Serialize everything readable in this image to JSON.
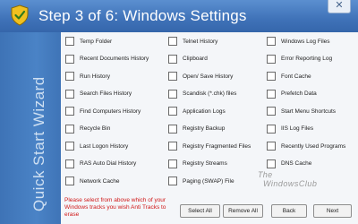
{
  "window": {
    "title": "Step 3 of 6: Windows Settings",
    "sidebar_label": "Quick Start Wizard",
    "close_glyph": "✕"
  },
  "options": [
    {
      "label": "Temp Folder",
      "checked": false
    },
    {
      "label": "Recent Documents History",
      "checked": false
    },
    {
      "label": "Run History",
      "checked": false
    },
    {
      "label": "Search Files History",
      "checked": false
    },
    {
      "label": "Find Computers History",
      "checked": false
    },
    {
      "label": "Recycle Bin",
      "checked": false
    },
    {
      "label": "Last Logon History",
      "checked": false
    },
    {
      "label": "RAS Auto Dial History",
      "checked": false
    },
    {
      "label": "Network Cache",
      "checked": false
    },
    {
      "label": "Telnet History",
      "checked": false
    },
    {
      "label": "Clipboard",
      "checked": false
    },
    {
      "label": "Open/ Save History",
      "checked": false
    },
    {
      "label": "Scandisk (*.chk) files",
      "checked": false
    },
    {
      "label": "Application Logs",
      "checked": false
    },
    {
      "label": "Registry Backup",
      "checked": false
    },
    {
      "label": "Registry Fragmented Files",
      "checked": false
    },
    {
      "label": "Registry Streams",
      "checked": false
    },
    {
      "label": "Paging (SWAP) File",
      "checked": false
    },
    {
      "label": "Windows Log Files",
      "checked": false
    },
    {
      "label": "Error Reporting Log",
      "checked": false
    },
    {
      "label": "Font Cache",
      "checked": false
    },
    {
      "label": "Prefetch Data",
      "checked": false
    },
    {
      "label": "Start Menu Shortcuts",
      "checked": false
    },
    {
      "label": "IIS Log Files",
      "checked": false
    },
    {
      "label": "Recently Used Programs",
      "checked": false
    },
    {
      "label": "DNS Cache",
      "checked": false
    }
  ],
  "footer": {
    "note": "Please select from above which of your Windows tracks you wish Anti Tracks to erase",
    "select_all": "Select All",
    "remove_all": "Remove All",
    "back": "Back",
    "next": "Next"
  },
  "watermark": {
    "line1": "The",
    "line2": "WindowsClub"
  },
  "colors": {
    "accent": "#3f72b8",
    "note": "#d01818"
  }
}
